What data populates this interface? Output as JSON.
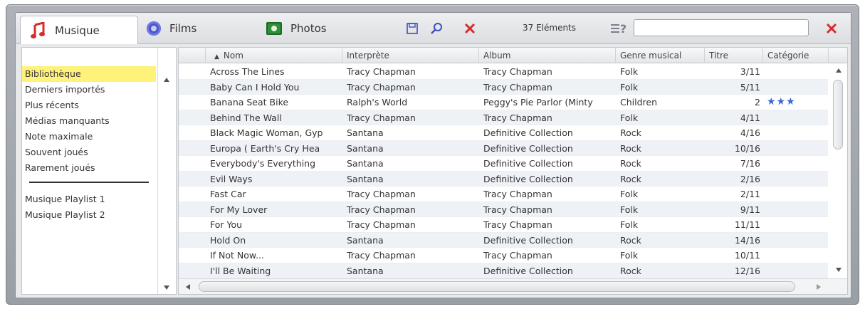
{
  "tabs": {
    "music_label": "Musique",
    "films_label": "Films",
    "photos_label": "Photos"
  },
  "toolbar": {
    "item_count": "37 Eléments",
    "help_icon_text": "?",
    "search_value": "",
    "icons": [
      "save-icon",
      "search-icon",
      "close-icon",
      "help-icon",
      "clear-search-icon"
    ],
    "accent_red": "#d42d2d",
    "accent_blue": "#3a67d4"
  },
  "sidebar": {
    "items": [
      {
        "label": "Bibliothèque"
      },
      {
        "label": "Derniers importés"
      },
      {
        "label": "Plus récents"
      },
      {
        "label": "Médias manquants"
      },
      {
        "label": "Note maximale"
      },
      {
        "label": "Souvent joués"
      },
      {
        "label": "Rarement joués"
      }
    ],
    "playlists": [
      {
        "label": "Musique Playlist 1"
      },
      {
        "label": "Musique Playlist 2"
      }
    ],
    "selected_color": "#fff27a"
  },
  "table": {
    "columns": {
      "name": "Nom",
      "sort_indicator": "▲",
      "artist": "Interprète",
      "album": "Album",
      "genre": "Genre musical",
      "track": "Titre",
      "category": "Catégorie"
    },
    "rows": [
      {
        "name": "Across The Lines",
        "artist": "Tracy Chapman",
        "album": "Tracy Chapman",
        "genre": "Folk",
        "track": "3/11",
        "category": ""
      },
      {
        "name": "Baby Can I Hold You",
        "artist": "Tracy Chapman",
        "album": "Tracy Chapman",
        "genre": "Folk",
        "track": "5/11",
        "category": ""
      },
      {
        "name": "Banana Seat Bike",
        "artist": "Ralph's World",
        "album": "Peggy's Pie Parlor (Minty",
        "genre": "Children",
        "track": "2",
        "category": "★★★"
      },
      {
        "name": "Behind The Wall",
        "artist": "Tracy Chapman",
        "album": "Tracy Chapman",
        "genre": "Folk",
        "track": "4/11",
        "category": ""
      },
      {
        "name": "Black Magic Woman, Gyp",
        "artist": "Santana",
        "album": "Definitive Collection",
        "genre": "Rock",
        "track": "4/16",
        "category": ""
      },
      {
        "name": "Europa ( Earth's Cry Hea",
        "artist": "Santana",
        "album": "Definitive Collection",
        "genre": "Rock",
        "track": "10/16",
        "category": ""
      },
      {
        "name": "Everybody's Everything",
        "artist": "Santana",
        "album": "Definitive Collection",
        "genre": "Rock",
        "track": "7/16",
        "category": ""
      },
      {
        "name": "Evil Ways",
        "artist": "Santana",
        "album": "Definitive Collection",
        "genre": "Rock",
        "track": "2/16",
        "category": ""
      },
      {
        "name": "Fast Car",
        "artist": "Tracy Chapman",
        "album": "Tracy Chapman",
        "genre": "Folk",
        "track": "2/11",
        "category": ""
      },
      {
        "name": "For My Lover",
        "artist": "Tracy Chapman",
        "album": "Tracy Chapman",
        "genre": "Folk",
        "track": "9/11",
        "category": ""
      },
      {
        "name": "For You",
        "artist": "Tracy Chapman",
        "album": "Tracy Chapman",
        "genre": "Folk",
        "track": "11/11",
        "category": ""
      },
      {
        "name": "Hold On",
        "artist": "Santana",
        "album": "Definitive Collection",
        "genre": "Rock",
        "track": "14/16",
        "category": ""
      },
      {
        "name": "If Not Now...",
        "artist": "Tracy Chapman",
        "album": "Tracy Chapman",
        "genre": "Folk",
        "track": "10/11",
        "category": ""
      },
      {
        "name": "I'll Be Waiting",
        "artist": "Santana",
        "album": "Definitive Collection",
        "genre": "Rock",
        "track": "12/16",
        "category": ""
      }
    ]
  }
}
